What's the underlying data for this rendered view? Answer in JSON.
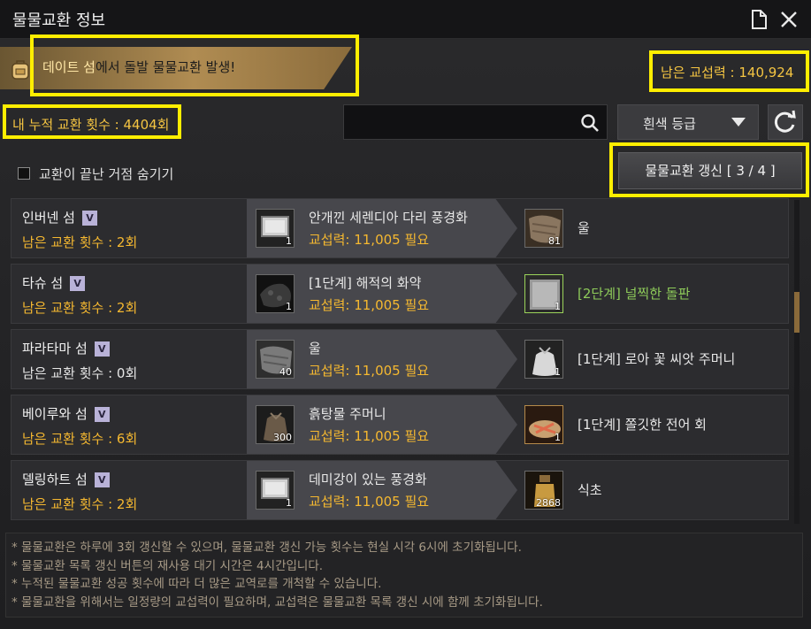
{
  "window": {
    "title": "물물교환 정보"
  },
  "banner": {
    "highlight": "데이트 섬",
    "text": "에서 돌발 물물교환 발생!"
  },
  "power": {
    "label": "남은 교섭력 : 140,924"
  },
  "exchange_count": {
    "label": "내 누적 교환 횟수 : 4404회"
  },
  "search": {
    "value": "",
    "placeholder": ""
  },
  "grade": {
    "selected": "흰색 등급"
  },
  "hide_finished": {
    "label": "교환이 끝난 거점 숨기기",
    "checked": false
  },
  "refresh_button": {
    "label": "물물교환 갱신 [ 3 / 4 ]"
  },
  "trades": [
    {
      "island": "인버넨 섬",
      "badge": "V",
      "remaining": "남은 교환 횟수 : 2회",
      "remaining_color": "gold",
      "give_name": "안개낀 세렌디아 다리 풍경화",
      "give_qty": "1",
      "give_cost": "교섭력: 11,005 필요",
      "receive_name": "울",
      "receive_qty": "81",
      "receive_color": "white"
    },
    {
      "island": "타슈 섬",
      "badge": "V",
      "remaining": "남은 교환 횟수 : 2회",
      "remaining_color": "gold",
      "give_name": "[1단계] 해적의 화약",
      "give_qty": "1",
      "give_cost": "교섭력: 11,005 필요",
      "receive_name": "[2단계] 널찍한 돌판",
      "receive_qty": "1",
      "receive_color": "green"
    },
    {
      "island": "파라타마 섬",
      "badge": "V",
      "remaining": "남은 교환 횟수 : 0회",
      "remaining_color": "white",
      "give_name": "울",
      "give_qty": "40",
      "give_cost": "교섭력: 11,005 필요",
      "receive_name": "[1단계] 로아 꽃 씨앗 주머니",
      "receive_qty": "1",
      "receive_color": "white"
    },
    {
      "island": "베이루와 섬",
      "badge": "V",
      "remaining": "남은 교환 횟수 : 6회",
      "remaining_color": "gold",
      "give_name": "흙탕물 주머니",
      "give_qty": "300",
      "give_cost": "교섭력: 11,005 필요",
      "receive_name": "[1단계] 쫄깃한 전어 회",
      "receive_qty": "1",
      "receive_color": "white"
    },
    {
      "island": "델링하트 섬",
      "badge": "V",
      "remaining": "남은 교환 횟수 : 2회",
      "remaining_color": "gold",
      "give_name": "데미강이 있는 풍경화",
      "give_qty": "1",
      "give_cost": "교섭력: 11,005 필요",
      "receive_name": "식초",
      "receive_qty": "2868",
      "receive_color": "white"
    }
  ],
  "notes": [
    "* 물물교환은 하루에 3회 갱신할 수 있으며, 물물교환 갱신 가능 횟수는 현실 시각 6시에 초기화됩니다.",
    "* 물물교환 목록 갱신 버튼의 재사용 대기 시간은 4시간입니다.",
    "* 누적된 물물교환 성공 횟수에 따라 더 많은 교역로를 개척할 수 있습니다.",
    "* 물물교환을 위해서는 일정량의 교섭력이 필요하며, 교섭력은 물물교환 목록 갱신 시에 함께 초기화됩니다."
  ],
  "colors": {
    "gold": "#f5b830",
    "green": "#8ecb5a",
    "highlight_box": "#ffee00"
  }
}
